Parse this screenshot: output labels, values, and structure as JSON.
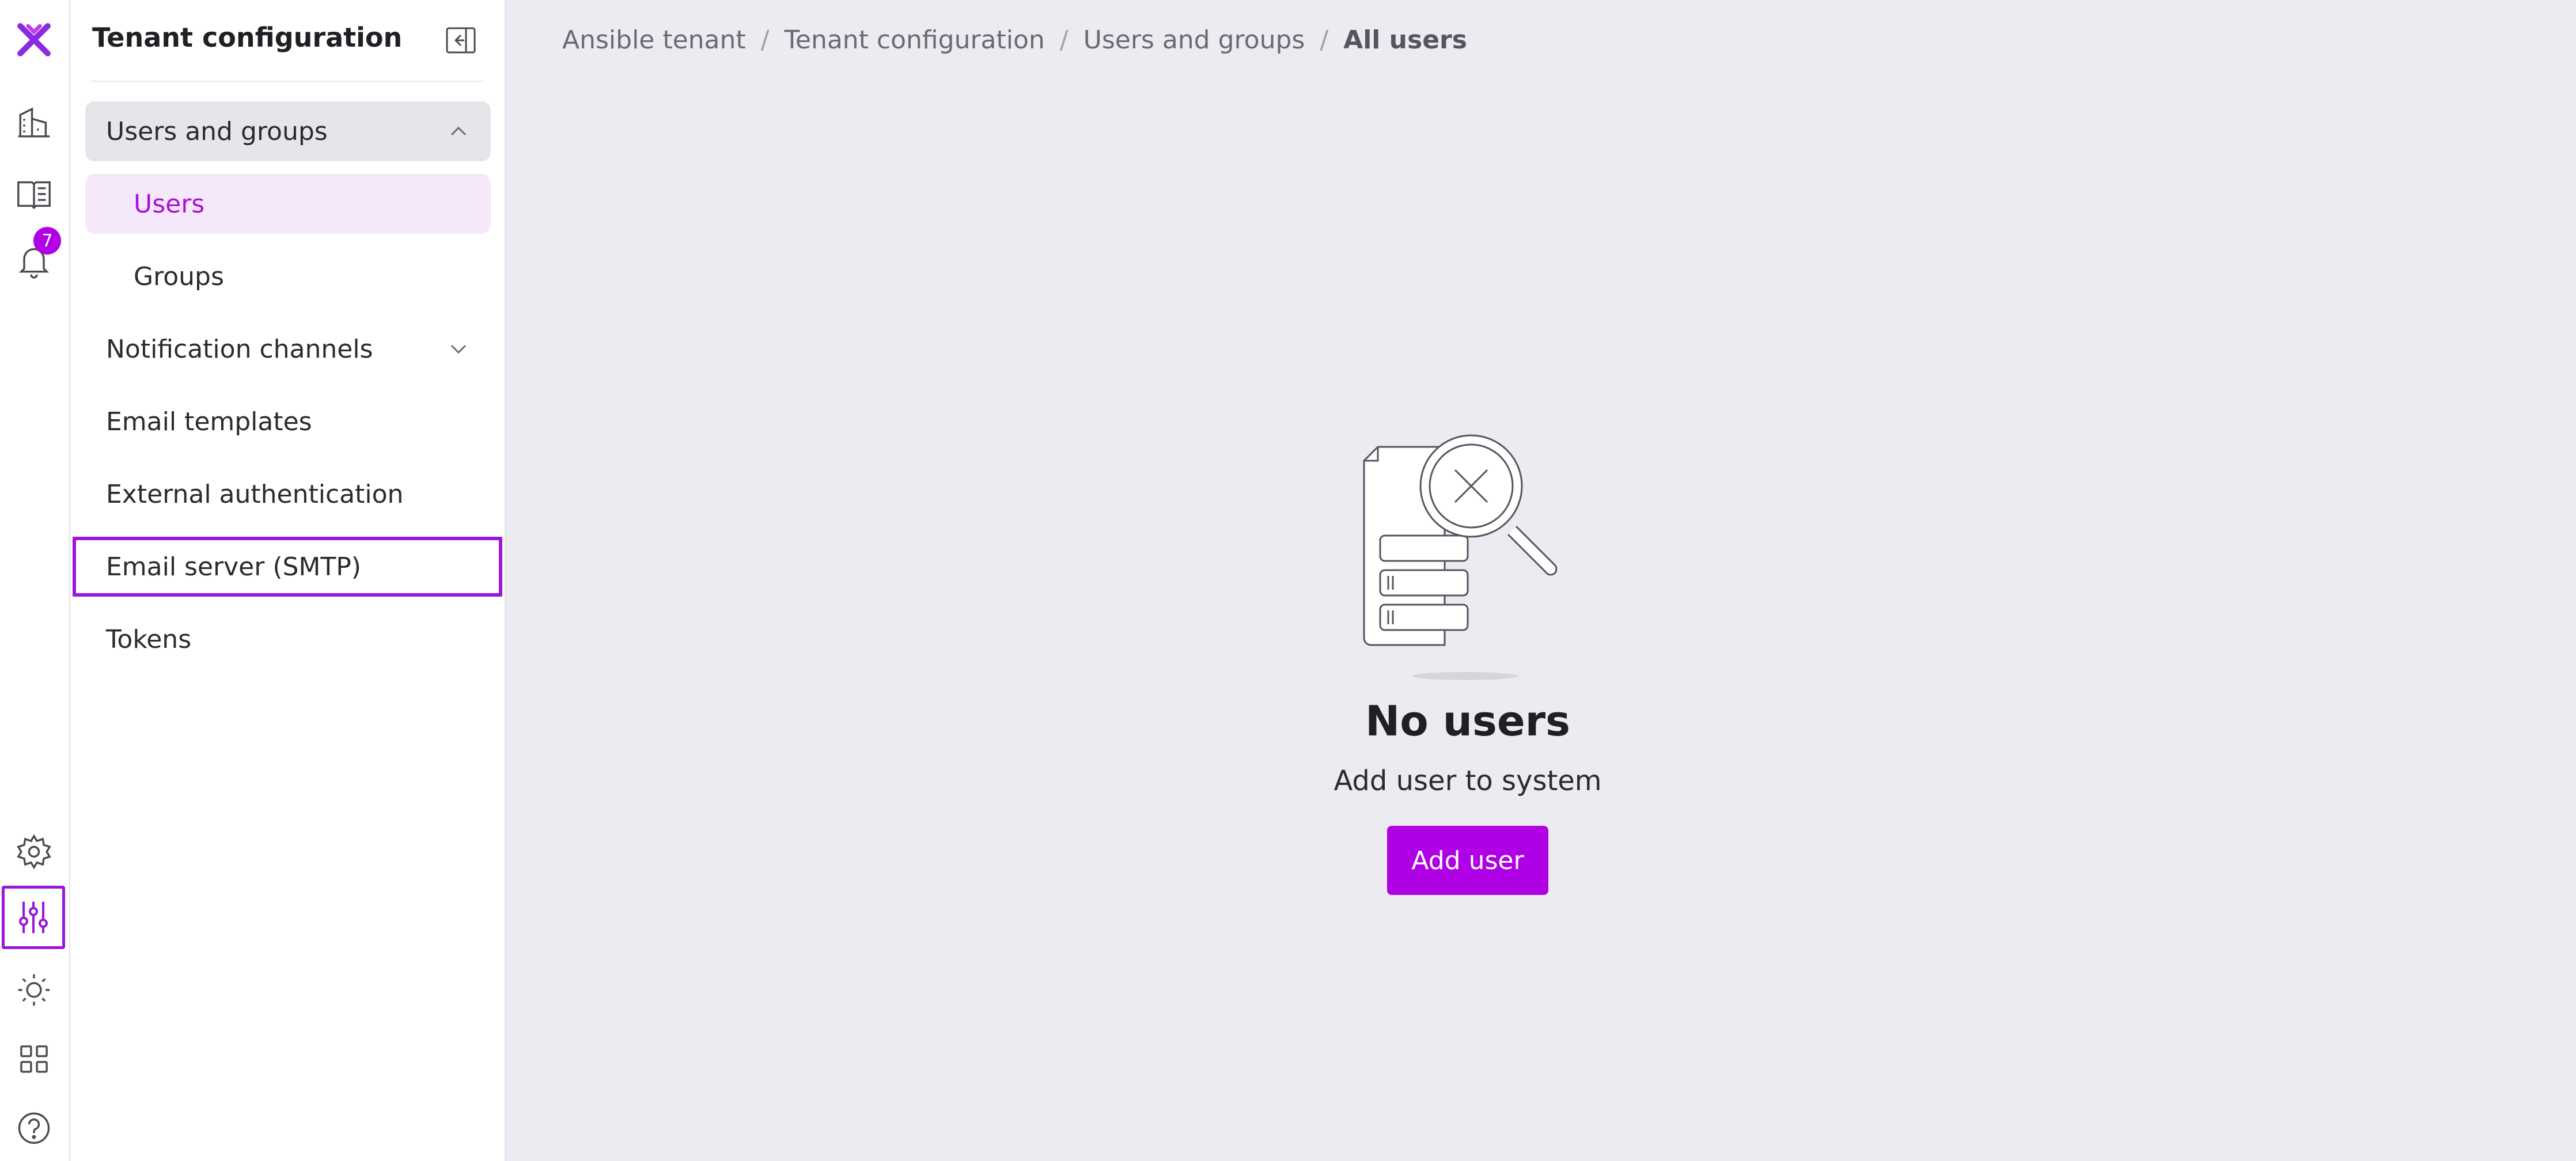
{
  "rail": {
    "notification_count": "7",
    "icons": [
      "logo-icon",
      "tenant-icon",
      "docs-icon",
      "bell-icon",
      "settings-icon",
      "sliders-icon",
      "theme-icon",
      "apps-icon",
      "help-icon"
    ],
    "accent_color": "#b000e6"
  },
  "panel": {
    "title": "Tenant configuration",
    "items": [
      {
        "label": "Users and groups",
        "state": "expanded"
      },
      {
        "label": "Users",
        "state": "selected"
      },
      {
        "label": "Groups"
      },
      {
        "label": "Notification channels",
        "state": "collapsed"
      },
      {
        "label": "Email templates"
      },
      {
        "label": "External authentication"
      },
      {
        "label": "Email server (SMTP)",
        "state": "focused"
      },
      {
        "label": "Tokens"
      }
    ]
  },
  "breadcrumb": [
    "Ansible tenant",
    "Tenant configuration",
    "Users and groups",
    "All users"
  ],
  "empty_state": {
    "title": "No users",
    "subtitle": "Add user to system",
    "button_label": "Add user"
  }
}
